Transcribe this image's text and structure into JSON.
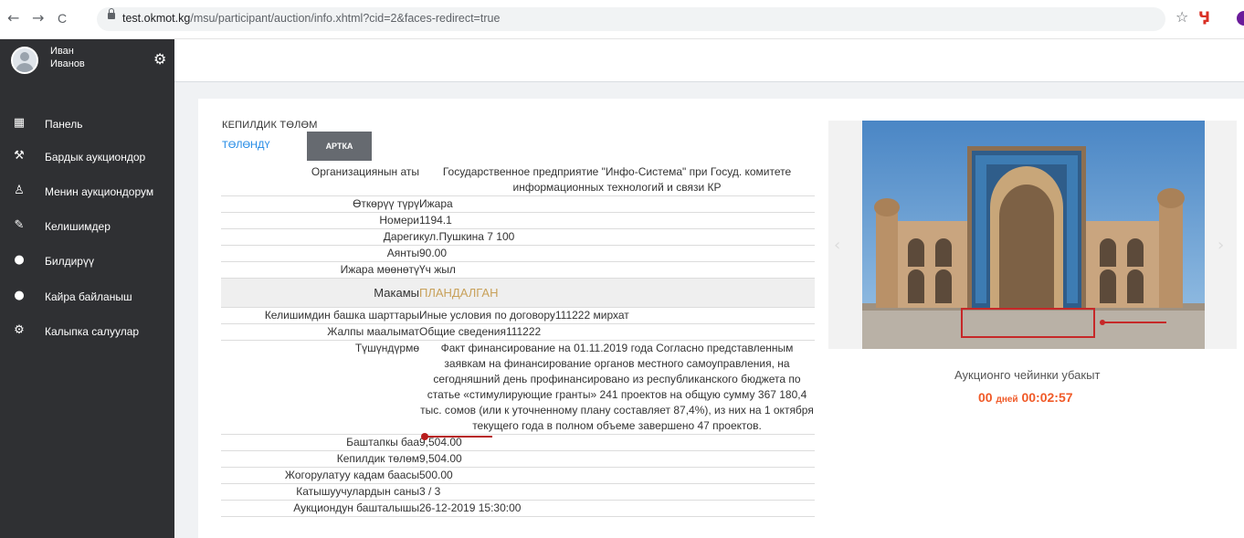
{
  "browser": {
    "back": "←",
    "forward": "→",
    "reload": "C",
    "url_host": "test.okmot.kg",
    "url_path": "/msu/participant/auction/info.xhtml?cid=2&faces-redirect=true",
    "star": "☆",
    "extension": "Ӌ"
  },
  "user": {
    "first_name": "Иван",
    "last_name": "Иванов",
    "settings": "⚙"
  },
  "sidebar": {
    "items": [
      {
        "label": "Панель",
        "icon": "▦"
      },
      {
        "label": "Бардык аукциондор",
        "icon": "⚒"
      },
      {
        "label": "Менин аукциондорум",
        "icon": "♙"
      },
      {
        "label": "Келишимдер",
        "icon": "✎"
      },
      {
        "label": "Билдирүү",
        "icon": "●"
      },
      {
        "label": "Кайра байланыш",
        "icon": "●"
      },
      {
        "label": "Калыпка салуулар",
        "icon": "⚙"
      }
    ]
  },
  "content": {
    "section_title": "КЕПИЛДИК ТӨЛӨМ",
    "pay_link": "ТӨЛӨНДҮ",
    "back_button": "АРТКА",
    "rows": {
      "org": {
        "label": "Организациянын аты",
        "value": "Государственное предприятие \"Инфо-Система\" при Госуд. комитете информационных технологий и связи КР"
      },
      "type": {
        "label": "Өткөрүү түрү",
        "value": "Ижара"
      },
      "number": {
        "label": "Номери",
        "value": "1194.1"
      },
      "address": {
        "label": "Дареги",
        "value": "кул.Пушкина 7 100"
      },
      "area": {
        "label": "Аянты",
        "value": "90.00"
      },
      "term": {
        "label": "Ижара мөөнөтү",
        "value": "Үч жыл"
      },
      "status": {
        "label": "Макамы",
        "value": "ПЛАНДАЛГАН"
      },
      "conditions": {
        "label": "Келишимдин башка шарттары",
        "value": "Иные условия по договору111222 мирхат"
      },
      "general": {
        "label": "Жалпы маалымат",
        "value": "Общие сведения111222"
      },
      "description": {
        "label": "Түшүндүрмө",
        "value": "Факт финансирование на 01.11.2019 года Согласно представленным заявкам на финансирование органов местного самоуправления, на сегодняшний день профинансировано из республиканского бюджета по статье «стимулирующие гранты» 241 проектов на общую сумму 367 180,4 тыс. сомов (или к уточненному плану составляет 87,4%), из них на 1 октября текущего года в полном объеме завершено 47 проектов."
      },
      "start_price": {
        "label": "Баштапкы баа",
        "value": "9,504.00"
      },
      "deposit": {
        "label": "Кепилдик төлөм",
        "value": "9,504.00"
      },
      "step": {
        "label": "Жогорулатуу кадам баасы",
        "value": "500.00"
      },
      "participants": {
        "label": "Катышуучулардын саны",
        "value": "3 / 3"
      },
      "start": {
        "label": "Аукциондун башталышы",
        "value": "26-12-2019 15:30:00"
      }
    }
  },
  "gallery": {
    "prev": "‹",
    "next": "›"
  },
  "timer": {
    "label": "Аукционго чейинки убакыт",
    "days": "00",
    "days_unit": "дней",
    "time": "00:02:57"
  }
}
